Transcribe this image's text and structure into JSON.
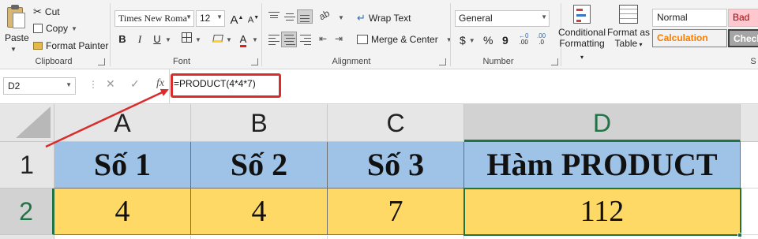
{
  "clipboard": {
    "paste_label": "Paste",
    "cut_label": "Cut",
    "copy_label": "Copy",
    "format_painter_label": "Format Painter",
    "group_label": "Clipboard"
  },
  "font": {
    "name": "Times New Roma",
    "size": "12",
    "grow": "A",
    "shrink": "A",
    "bold": "B",
    "italic": "I",
    "underline": "U",
    "font_color_letter": "A",
    "group_label": "Font"
  },
  "alignment": {
    "wrap_text_label": "Wrap Text",
    "merge_center_label": "Merge & Center",
    "group_label": "Alignment"
  },
  "number": {
    "format": "General",
    "currency": "$",
    "percent": "%",
    "comma": "9",
    "inc_decimals": ".00",
    "dec_decimals": ".0",
    "group_label": "Number"
  },
  "styles": {
    "conditional_formatting_line1": "Conditional",
    "conditional_formatting_line2": "Formatting",
    "format_as_table_line1": "Format as",
    "format_as_table_line2": "Table",
    "normal_label": "Normal",
    "bad_label": "Bad",
    "calculation_label": "Calculation",
    "check_label": "Check",
    "group_label": "S"
  },
  "formula_bar": {
    "name_box": "D2",
    "cancel_symbol": "✕",
    "enter_symbol": "✓",
    "fx_symbol": "fx",
    "formula": "=PRODUCT(4*4*7)"
  },
  "grid": {
    "columns": [
      "A",
      "B",
      "C",
      "D"
    ],
    "rows": [
      "1",
      "2"
    ],
    "header_row": [
      "Số 1",
      "Số 2",
      "Số 3",
      "Hàm PRODUCT"
    ],
    "value_row": [
      "4",
      "4",
      "7",
      "112"
    ],
    "selected_cell": "D2"
  },
  "colors": {
    "header_fill": "#9fc3e6",
    "value_fill": "#ffd966",
    "selection_green": "#217346",
    "annotation_red": "#d92c2c"
  }
}
